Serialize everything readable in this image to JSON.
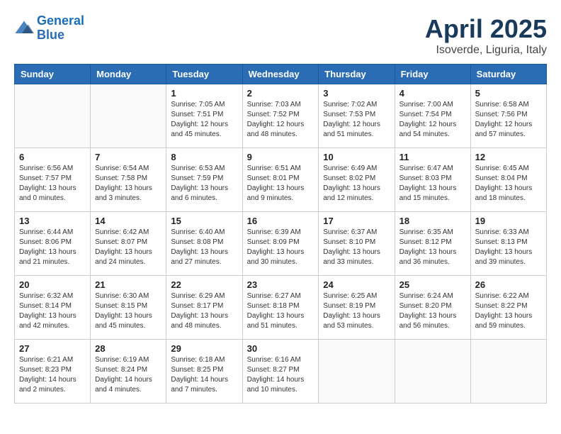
{
  "header": {
    "logo_line1": "General",
    "logo_line2": "Blue",
    "month_year": "April 2025",
    "location": "Isoverde, Liguria, Italy"
  },
  "weekdays": [
    "Sunday",
    "Monday",
    "Tuesday",
    "Wednesday",
    "Thursday",
    "Friday",
    "Saturday"
  ],
  "weeks": [
    [
      {
        "day": "",
        "info": ""
      },
      {
        "day": "",
        "info": ""
      },
      {
        "day": "1",
        "info": "Sunrise: 7:05 AM\nSunset: 7:51 PM\nDaylight: 12 hours and 45 minutes."
      },
      {
        "day": "2",
        "info": "Sunrise: 7:03 AM\nSunset: 7:52 PM\nDaylight: 12 hours and 48 minutes."
      },
      {
        "day": "3",
        "info": "Sunrise: 7:02 AM\nSunset: 7:53 PM\nDaylight: 12 hours and 51 minutes."
      },
      {
        "day": "4",
        "info": "Sunrise: 7:00 AM\nSunset: 7:54 PM\nDaylight: 12 hours and 54 minutes."
      },
      {
        "day": "5",
        "info": "Sunrise: 6:58 AM\nSunset: 7:56 PM\nDaylight: 12 hours and 57 minutes."
      }
    ],
    [
      {
        "day": "6",
        "info": "Sunrise: 6:56 AM\nSunset: 7:57 PM\nDaylight: 13 hours and 0 minutes."
      },
      {
        "day": "7",
        "info": "Sunrise: 6:54 AM\nSunset: 7:58 PM\nDaylight: 13 hours and 3 minutes."
      },
      {
        "day": "8",
        "info": "Sunrise: 6:53 AM\nSunset: 7:59 PM\nDaylight: 13 hours and 6 minutes."
      },
      {
        "day": "9",
        "info": "Sunrise: 6:51 AM\nSunset: 8:01 PM\nDaylight: 13 hours and 9 minutes."
      },
      {
        "day": "10",
        "info": "Sunrise: 6:49 AM\nSunset: 8:02 PM\nDaylight: 13 hours and 12 minutes."
      },
      {
        "day": "11",
        "info": "Sunrise: 6:47 AM\nSunset: 8:03 PM\nDaylight: 13 hours and 15 minutes."
      },
      {
        "day": "12",
        "info": "Sunrise: 6:45 AM\nSunset: 8:04 PM\nDaylight: 13 hours and 18 minutes."
      }
    ],
    [
      {
        "day": "13",
        "info": "Sunrise: 6:44 AM\nSunset: 8:06 PM\nDaylight: 13 hours and 21 minutes."
      },
      {
        "day": "14",
        "info": "Sunrise: 6:42 AM\nSunset: 8:07 PM\nDaylight: 13 hours and 24 minutes."
      },
      {
        "day": "15",
        "info": "Sunrise: 6:40 AM\nSunset: 8:08 PM\nDaylight: 13 hours and 27 minutes."
      },
      {
        "day": "16",
        "info": "Sunrise: 6:39 AM\nSunset: 8:09 PM\nDaylight: 13 hours and 30 minutes."
      },
      {
        "day": "17",
        "info": "Sunrise: 6:37 AM\nSunset: 8:10 PM\nDaylight: 13 hours and 33 minutes."
      },
      {
        "day": "18",
        "info": "Sunrise: 6:35 AM\nSunset: 8:12 PM\nDaylight: 13 hours and 36 minutes."
      },
      {
        "day": "19",
        "info": "Sunrise: 6:33 AM\nSunset: 8:13 PM\nDaylight: 13 hours and 39 minutes."
      }
    ],
    [
      {
        "day": "20",
        "info": "Sunrise: 6:32 AM\nSunset: 8:14 PM\nDaylight: 13 hours and 42 minutes."
      },
      {
        "day": "21",
        "info": "Sunrise: 6:30 AM\nSunset: 8:15 PM\nDaylight: 13 hours and 45 minutes."
      },
      {
        "day": "22",
        "info": "Sunrise: 6:29 AM\nSunset: 8:17 PM\nDaylight: 13 hours and 48 minutes."
      },
      {
        "day": "23",
        "info": "Sunrise: 6:27 AM\nSunset: 8:18 PM\nDaylight: 13 hours and 51 minutes."
      },
      {
        "day": "24",
        "info": "Sunrise: 6:25 AM\nSunset: 8:19 PM\nDaylight: 13 hours and 53 minutes."
      },
      {
        "day": "25",
        "info": "Sunrise: 6:24 AM\nSunset: 8:20 PM\nDaylight: 13 hours and 56 minutes."
      },
      {
        "day": "26",
        "info": "Sunrise: 6:22 AM\nSunset: 8:22 PM\nDaylight: 13 hours and 59 minutes."
      }
    ],
    [
      {
        "day": "27",
        "info": "Sunrise: 6:21 AM\nSunset: 8:23 PM\nDaylight: 14 hours and 2 minutes."
      },
      {
        "day": "28",
        "info": "Sunrise: 6:19 AM\nSunset: 8:24 PM\nDaylight: 14 hours and 4 minutes."
      },
      {
        "day": "29",
        "info": "Sunrise: 6:18 AM\nSunset: 8:25 PM\nDaylight: 14 hours and 7 minutes."
      },
      {
        "day": "30",
        "info": "Sunrise: 6:16 AM\nSunset: 8:27 PM\nDaylight: 14 hours and 10 minutes."
      },
      {
        "day": "",
        "info": ""
      },
      {
        "day": "",
        "info": ""
      },
      {
        "day": "",
        "info": ""
      }
    ]
  ]
}
